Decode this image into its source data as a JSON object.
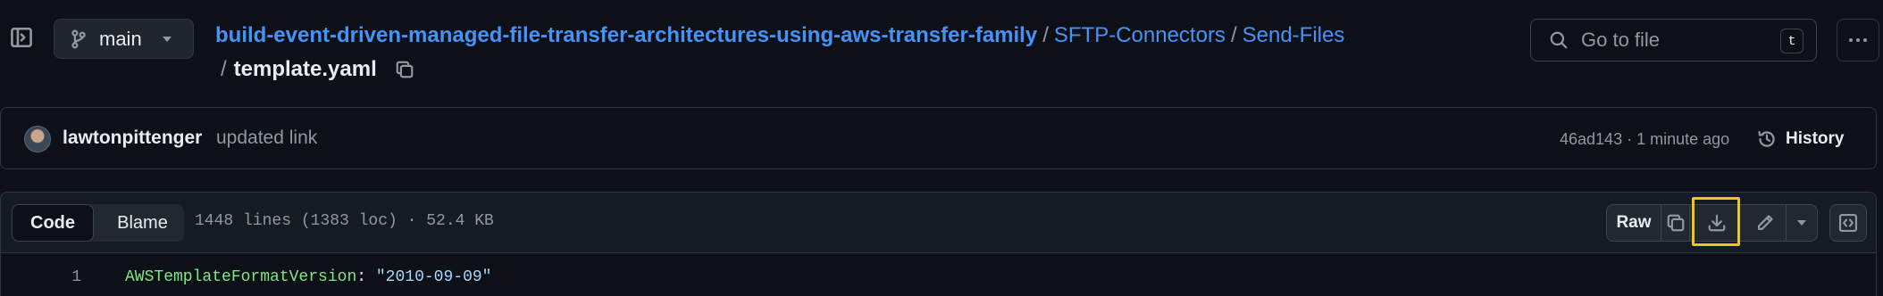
{
  "colors": {
    "background": "#0d1117",
    "link": "#4493f8",
    "muted": "#9198a1",
    "highlight": "#f0c419",
    "yaml_key": "#7ee787",
    "yaml_string": "#a5d6ff"
  },
  "header": {
    "sidebar_toggle_icon": "sidebar-expand-icon",
    "branch": {
      "icon": "git-branch-icon",
      "label": "main",
      "caret_icon": "triangle-down-icon"
    },
    "breadcrumb": {
      "repo": "build-event-driven-managed-file-transfer-architectures-using-aws-transfer-family",
      "separator": "/",
      "folders": [
        "SFTP-Connectors",
        "Send-Files"
      ],
      "file": "template.yaml",
      "copy_icon": "copy-icon"
    },
    "search": {
      "icon": "search-icon",
      "placeholder": "Go to file",
      "shortcut": "t"
    },
    "more_icon": "kebab-horizontal-icon"
  },
  "commit": {
    "author": "lawtonpittenger",
    "message": "updated link",
    "meta": "46ad143 · 1 minute ago",
    "history_icon": "history-icon",
    "history_label": "History"
  },
  "file_header": {
    "tabs": [
      "Code",
      "Blame"
    ],
    "active_tab": "Code",
    "stats": "1448 lines (1383 loc) · 52.4 KB",
    "raw_label": "Raw",
    "copy_raw_icon": "copy-icon",
    "download_icon": "download-icon",
    "edit_icon": "pencil-icon",
    "edit_caret_icon": "triangle-down-icon",
    "symbols_icon": "code-square-icon"
  },
  "code": {
    "lines": [
      {
        "number": "1",
        "key": "AWSTemplateFormatVersion",
        "punct": ": ",
        "value": "\"2010-09-09\""
      }
    ]
  }
}
